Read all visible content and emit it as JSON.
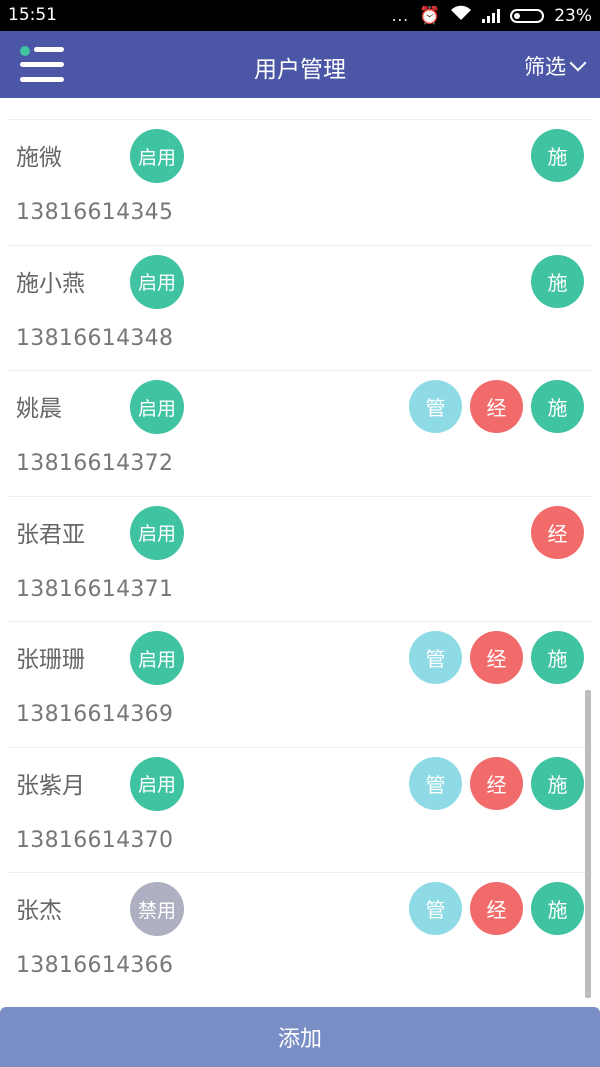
{
  "status_bar": {
    "time": "15:51",
    "more": "...",
    "battery_percent": "23%"
  },
  "header": {
    "title": "用户管理",
    "filter_label": "筛选"
  },
  "colors": {
    "header_bg": "#4b57a6",
    "enabled": "#3fc3a1",
    "disabled": "#aeb0c1",
    "role_manage": "#8edbe6",
    "role_manager": "#f26b6b",
    "role_construct": "#3fc3a1",
    "add_button": "#7a8ec6"
  },
  "users": [
    {
      "name": "施微",
      "phone": "13816614345",
      "status": "启用",
      "roles": [
        "施"
      ]
    },
    {
      "name": "施小燕",
      "phone": "13816614348",
      "status": "启用",
      "roles": [
        "施"
      ]
    },
    {
      "name": "姚晨",
      "phone": "13816614372",
      "status": "启用",
      "roles": [
        "管",
        "经",
        "施"
      ]
    },
    {
      "name": "张君亚",
      "phone": "13816614371",
      "status": "启用",
      "roles": [
        "经"
      ]
    },
    {
      "name": "张珊珊",
      "phone": "13816614369",
      "status": "启用",
      "roles": [
        "管",
        "经",
        "施"
      ]
    },
    {
      "name": "张紫月",
      "phone": "13816614370",
      "status": "启用",
      "roles": [
        "管",
        "经",
        "施"
      ]
    },
    {
      "name": "张杰",
      "phone": "13816614366",
      "status": "禁用",
      "roles": [
        "管",
        "经",
        "施"
      ]
    }
  ],
  "add_button_label": "添加"
}
